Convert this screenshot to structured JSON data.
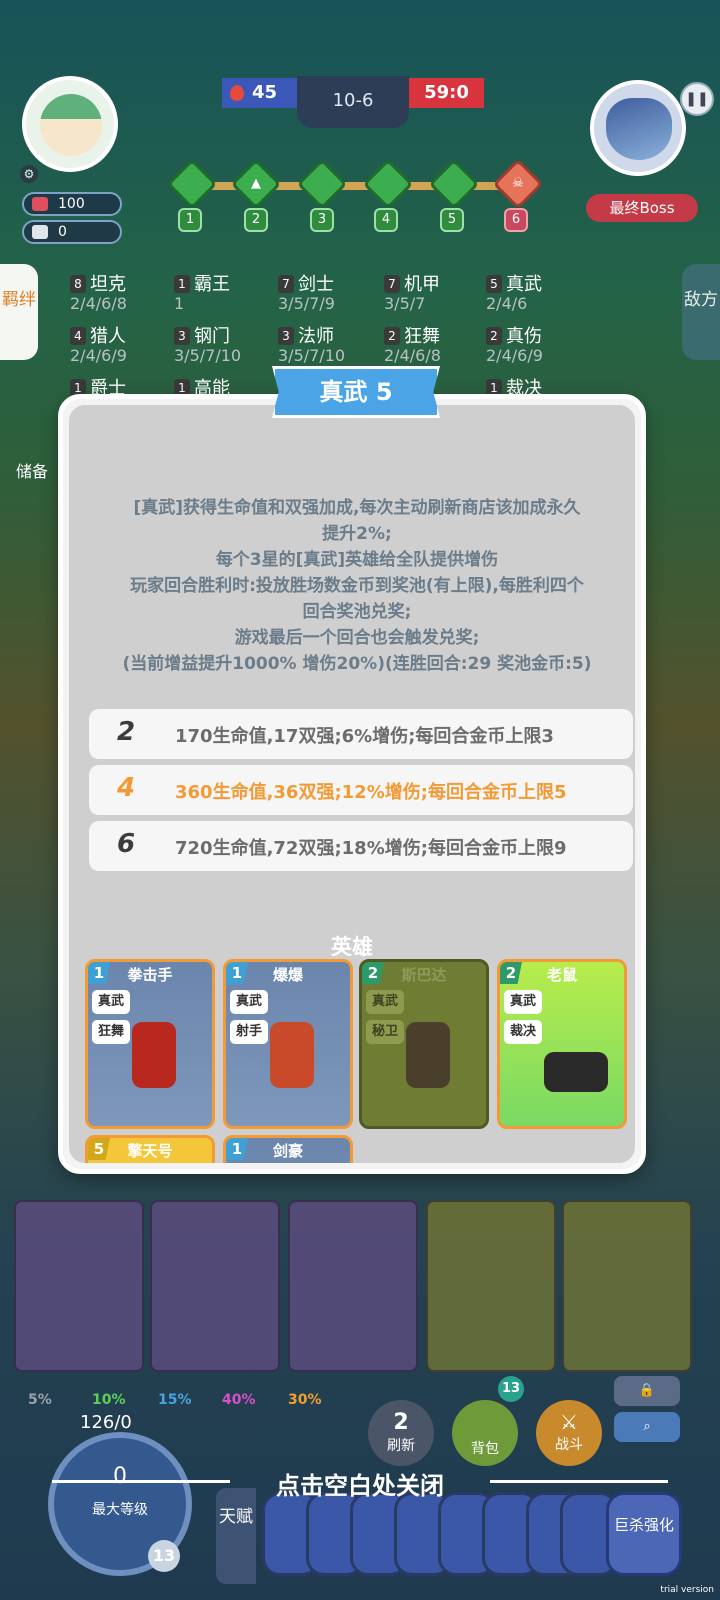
{
  "hud": {
    "hp": "100",
    "coins": "0",
    "score_left": "45",
    "round": "10-6",
    "score_right": "59:0",
    "boss_label": "最终Boss",
    "stages": [
      "1",
      "2",
      "3",
      "4",
      "5",
      "6"
    ]
  },
  "side": {
    "left_tab": "羁绊",
    "right_tab": "敌方",
    "store": "储备"
  },
  "synergies": [
    {
      "count": "8",
      "name": "坦克",
      "tiers": "2/4/6/8"
    },
    {
      "count": "1",
      "name": "霸王",
      "tiers": "1"
    },
    {
      "count": "7",
      "name": "剑士",
      "tiers": "3/5/7/9"
    },
    {
      "count": "7",
      "name": "机甲",
      "tiers": "3/5/7"
    },
    {
      "count": "5",
      "name": "真武",
      "tiers": "2/4/6"
    },
    {
      "count": "4",
      "name": "猎人",
      "tiers": "2/4/6/9"
    },
    {
      "count": "3",
      "name": "钢门",
      "tiers": "3/5/7/10"
    },
    {
      "count": "3",
      "name": "法师",
      "tiers": "3/5/7/10"
    },
    {
      "count": "2",
      "name": "狂舞",
      "tiers": "2/4/6/8"
    },
    {
      "count": "2",
      "name": "真伤",
      "tiers": "2/4/6/9"
    },
    {
      "count": "1",
      "name": "爵士",
      "tiers": ""
    },
    {
      "count": "1",
      "name": "高能",
      "tiers": ""
    },
    {
      "count": "1",
      "name": "裁决",
      "tiers": ""
    }
  ],
  "modal": {
    "title": "真武 5",
    "description": [
      "[真武]获得生命值和双强加成,每次主动刷新商店该加成永久",
      "提升2%;",
      "每个3星的[真武]英雄给全队提供增伤",
      "玩家回合胜利时:投放胜场数金币到奖池(有上限),每胜利四个",
      "回合奖池兑奖;",
      "游戏最后一个回合也会触发兑奖;",
      "(当前增益提升1000% 增伤20%)(连胜回合:29 奖池金币:5)"
    ],
    "tiers": [
      {
        "num": "2",
        "text": "170生命值,17双强;6%增伤;每回合金币上限3",
        "active": false
      },
      {
        "num": "4",
        "text": "360生命值,36双强;12%增伤;每回合金币上限5",
        "active": true
      },
      {
        "num": "6",
        "text": "720生命值,72双强;18%增伤;每回合金币上限9",
        "active": false
      }
    ],
    "heroes_title": "英雄",
    "heroes": [
      {
        "cost": "1",
        "name": "拳击手",
        "tags": [
          "真武",
          "狂舞"
        ],
        "style": "blue"
      },
      {
        "cost": "1",
        "name": "爆爆",
        "tags": [
          "真武",
          "射手"
        ],
        "style": "blue"
      },
      {
        "cost": "2",
        "name": "斯巴达",
        "tags": [
          "真武",
          "秘卫"
        ],
        "style": "olive"
      },
      {
        "cost": "2",
        "name": "老鼠",
        "tags": [
          "真武",
          "裁决"
        ],
        "style": "lime"
      },
      {
        "cost": "5",
        "name": "擎天号",
        "tags": [],
        "style": "yellow"
      },
      {
        "cost": "1",
        "name": "剑豪",
        "tags": [],
        "style": "blue"
      }
    ]
  },
  "bottom": {
    "odds": [
      "5%",
      "10%",
      "15%",
      "40%",
      "30%"
    ],
    "odds_colors": [
      "#9aa3ad",
      "#5ccf5a",
      "#4aa3e0",
      "#d850c8",
      "#f0a030"
    ],
    "level_top": "126/0",
    "level_value": "0",
    "level_label": "最大等级",
    "level_badge": "13",
    "refresh_cost": "2",
    "refresh_label": "刷新",
    "bag_label": "背包",
    "bag_count": "13",
    "fight_label": "战斗",
    "talent_label": "天赋",
    "final_talent": "巨杀强化",
    "close_hint": "点击空白处关闭",
    "trial": "trial version"
  }
}
